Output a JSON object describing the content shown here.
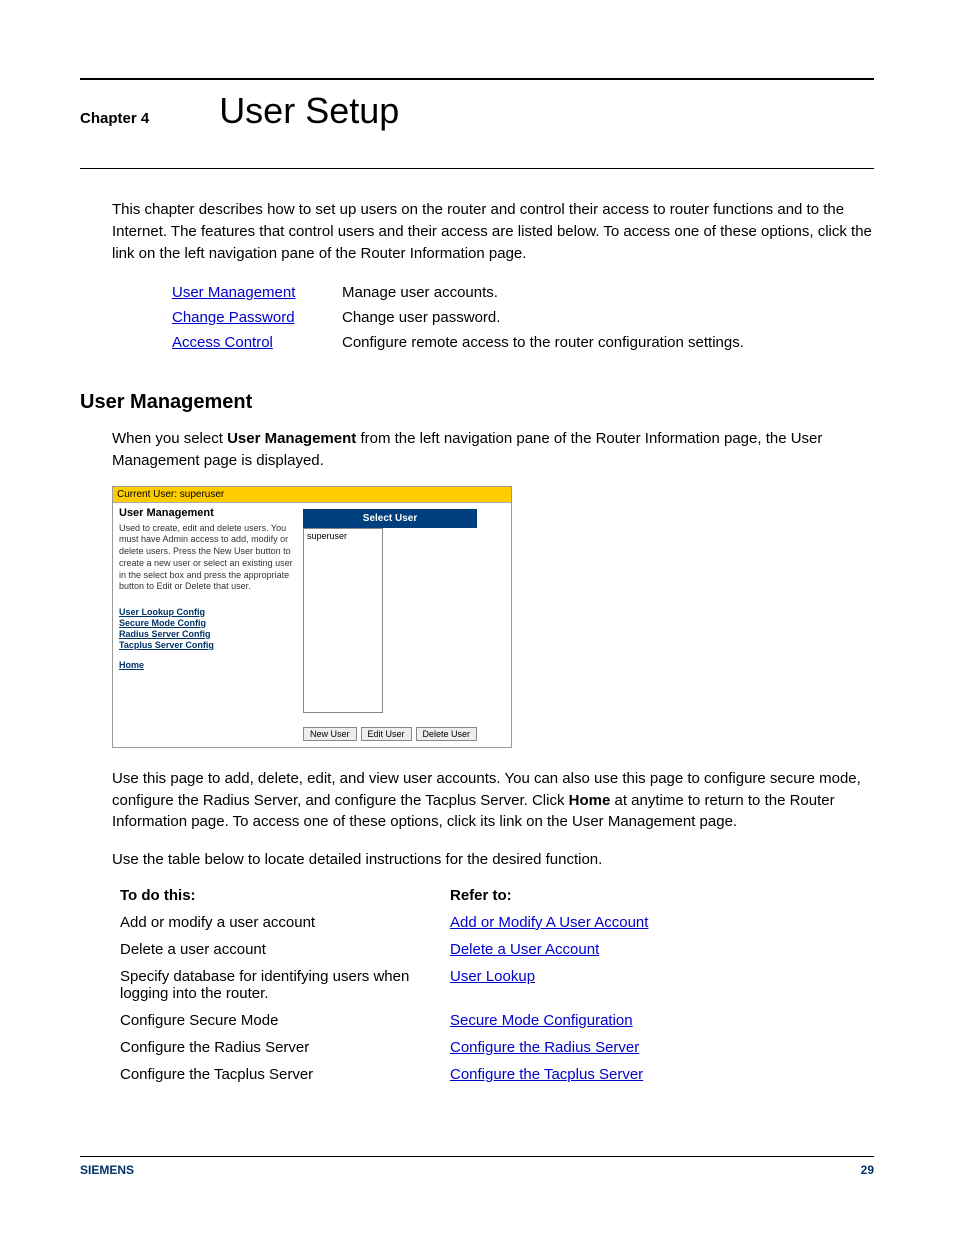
{
  "chapter": {
    "label": "Chapter 4",
    "title": "User Setup"
  },
  "intro": "This chapter describes how to set up users on the router and control their access to router functions and to the Internet. The features that control users and their access are listed below. To access one of these options, click the link on the left navigation pane of the Router Information page.",
  "features": [
    {
      "link": "User Management",
      "desc": "Manage user accounts."
    },
    {
      "link": "Change Password",
      "desc": "Change user password."
    },
    {
      "link": "Access Control",
      "desc": "Configure remote access to the router configuration settings."
    }
  ],
  "section": {
    "heading": "User Management",
    "intro_prefix": "When you select ",
    "intro_bold": "User Management",
    "intro_suffix": " from the left navigation pane of the Router Information page, the User Management page is displayed."
  },
  "screenshot": {
    "topbar": "Current User: superuser",
    "title": "User Management",
    "desc": "Used to create, edit and delete users. You must have Admin access to add, modify or delete users. Press the New User button to create a new user or select an existing user in the select box and press the appropriate button to Edit or Delete that user.",
    "links": [
      "User Lookup Config",
      "Secure Mode Config",
      "Radius Server Config",
      "Tacplus Server Config"
    ],
    "home": "Home",
    "select_header": "Select User",
    "listbox_item": "superuser",
    "buttons": [
      "New User",
      "Edit User",
      "Delete User"
    ]
  },
  "after_ss_1_prefix": "Use this page to add, delete, edit, and view user accounts. You can also use this page to configure secure mode, configure the Radius Server, and configure the Tacplus Server. Click ",
  "after_ss_1_bold": "Home",
  "after_ss_1_suffix": " at anytime to return to the Router Information page. To access one of these options, click its link on the User Management page.",
  "after_ss_2": "Use the table below to locate detailed instructions for the desired function.",
  "instr_header": {
    "left": "To do this:",
    "right": "Refer to:"
  },
  "instructions": [
    {
      "left": "Add or modify a user account",
      "right": "Add or Modify A User Account"
    },
    {
      "left": "Delete a user account",
      "right": "Delete a User Account"
    },
    {
      "left": "Specify database for identifying users when logging into the router.",
      "right": "User Lookup"
    },
    {
      "left": "Configure Secure Mode",
      "right": "Secure Mode Configuration"
    },
    {
      "left": "Configure the Radius Server",
      "right": "Configure the Radius Server"
    },
    {
      "left": "Configure the Tacplus Server",
      "right": "Configure the Tacplus Server"
    }
  ],
  "footer": {
    "brand": "SIEMENS",
    "page": "29"
  }
}
